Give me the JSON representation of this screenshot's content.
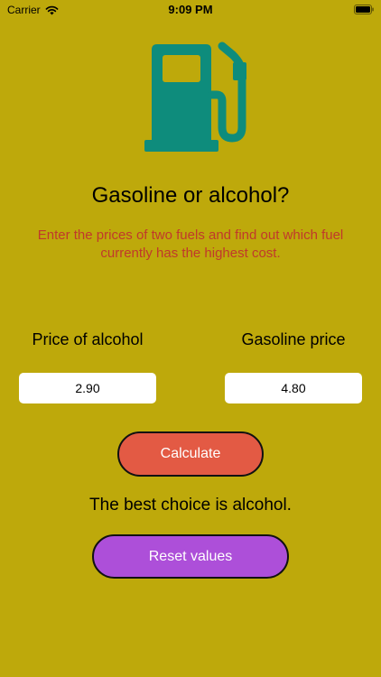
{
  "status_bar": {
    "carrier": "Carrier",
    "time": "9:09 PM",
    "icons": [
      "wifi-icon",
      "battery-icon"
    ]
  },
  "header": {
    "icon": "fuel-pump-icon",
    "title": "Gasoline or alcohol?",
    "subtitle": "Enter the prices of two fuels and find out which fuel currently has the highest cost."
  },
  "form": {
    "alcohol_label": "Price of alcohol",
    "alcohol_value": "2.90",
    "gasoline_label": "Gasoline price",
    "gasoline_value": "4.80"
  },
  "actions": {
    "calculate_label": "Calculate",
    "reset_label": "Reset values"
  },
  "result": {
    "text": "The best choice is alcohol."
  },
  "colors": {
    "background": "#bea90b",
    "pump": "#0e8c7c",
    "subtitle": "#c0392b",
    "calculate_button": "#e35a44",
    "reset_button": "#ad4fd9"
  }
}
